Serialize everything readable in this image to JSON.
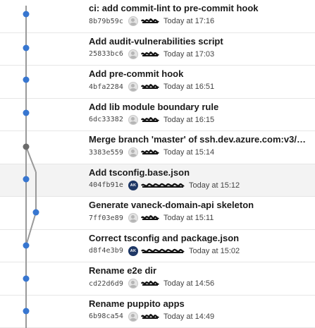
{
  "graph": {
    "main_color": "#3776d0",
    "line_color": "#9a9a9a",
    "merge_color": "#6b6b6b"
  },
  "commits": [
    {
      "title": "ci: add commit-lint to pre-commit hook",
      "hash": "8b79b59c",
      "time": "Today at 17:16",
      "avatar": "generic"
    },
    {
      "title": "Add audit-vulnerabilities script",
      "hash": "25833bc6",
      "time": "Today at 17:03",
      "avatar": "generic"
    },
    {
      "title": "Add pre-commit hook",
      "hash": "4bfa2284",
      "time": "Today at 16:51",
      "avatar": "generic"
    },
    {
      "title": "Add lib module boundary rule",
      "hash": "6dc33382",
      "time": "Today at 16:15",
      "avatar": "generic"
    },
    {
      "title": "Merge branch 'master' of ssh.dev.azure.com:v3/t…",
      "hash": "3383e559",
      "time": "Today at 15:14",
      "avatar": "generic"
    },
    {
      "title": "Add tsconfig.base.json",
      "hash": "404fb91e",
      "time": "Today at 15:12",
      "avatar": "initials",
      "initials": "AK"
    },
    {
      "title": "Generate vaneck-domain-api skeleton",
      "hash": "7ff03e89",
      "time": "Today at 15:11",
      "avatar": "generic"
    },
    {
      "title": "Correct tsconfig and package.json",
      "hash": "d8f4e3b9",
      "time": "Today at 15:02",
      "avatar": "initials",
      "initials": "AK"
    },
    {
      "title": "Rename e2e dir",
      "hash": "cd22d6d9",
      "time": "Today at 14:56",
      "avatar": "generic"
    },
    {
      "title": "Rename puppito apps",
      "hash": "6b98ca54",
      "time": "Today at 14:49",
      "avatar": "generic"
    }
  ]
}
